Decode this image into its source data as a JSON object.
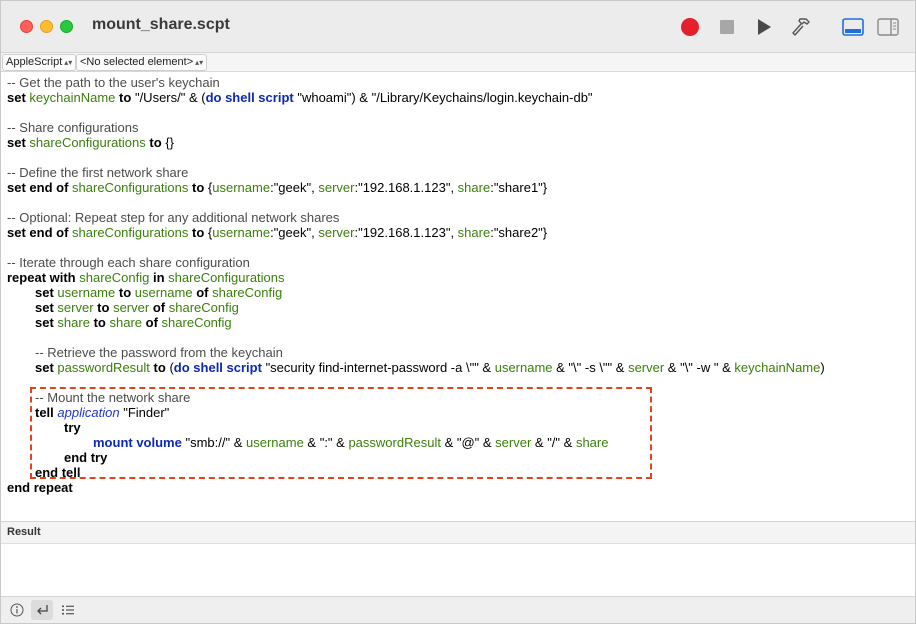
{
  "window": {
    "title": "mount_share.scpt"
  },
  "toolbar": {
    "record": "record-button",
    "stop": "stop-button",
    "run": "run-button",
    "compile": "hammer-icon",
    "show_result_pane": "bottom-panel-icon",
    "show_sidebar": "sidebar-icon"
  },
  "navbar": {
    "language": "AppleScript",
    "element": "<No selected element>"
  },
  "code": {
    "c1": "-- Get the path to the user's keychain",
    "l2": {
      "set": "set",
      "keychainName": "keychainName",
      "to": "to",
      "s1": "\"/Users/\" & (",
      "do": "do shell script",
      "s2": "\"whoami\") & \"/Library/Keychains/login.keychain-db\""
    },
    "c4": "-- Share configurations",
    "l5": {
      "set": "set",
      "shareConfigurations": "shareConfigurations",
      "to": "to",
      "rest": "{}"
    },
    "c7": "-- Define the first network share",
    "l8": {
      "setendof": "set end of",
      "shareConfigurations": "shareConfigurations",
      "to": "to",
      "brace": "{",
      "username": "username",
      "s_user": ":\"geek\", ",
      "server": "server",
      "s_server": ":\"192.168.1.123\", ",
      "share": "share",
      "s_share": ":\"share1\"}"
    },
    "c10": "-- Optional: Repeat step for any additional network shares",
    "l11": {
      "setendof": "set end of",
      "shareConfigurations": "shareConfigurations",
      "to": "to",
      "brace": "{",
      "username": "username",
      "s_user": ":\"geek\", ",
      "server": "server",
      "s_server": ":\"192.168.1.123\", ",
      "share": "share",
      "s_share": ":\"share2\"}"
    },
    "c13": "-- Iterate through each share configuration",
    "l14": {
      "repeatwith": "repeat with",
      "shareConfig": "shareConfig",
      "in": "in",
      "shareConfigurations": "shareConfigurations"
    },
    "l15": {
      "set": "set",
      "v1": "username",
      "to": "to",
      "v2": "username",
      "of": "of",
      "v3": "shareConfig"
    },
    "l16": {
      "set": "set",
      "v1": "server",
      "to": "to",
      "v2": "server",
      "of": "of",
      "v3": "shareConfig"
    },
    "l17": {
      "set": "set",
      "v1": "share",
      "to": "to",
      "v2": "share",
      "of": "of",
      "v3": "shareConfig"
    },
    "c19": "-- Retrieve the password from the keychain",
    "l20": {
      "set": "set",
      "passwordResult": "passwordResult",
      "to": "to",
      "p1": "(",
      "do": "do shell script",
      "s1": "\"security find-internet-password -a \\\"\" & ",
      "username": "username",
      "s2": " & \"\\\" -s \\\"\" & ",
      "server": "server",
      "s3": " & \"\\\" -w \" & ",
      "keychainName": "keychainName",
      "p2": ")"
    },
    "c22": "-- Mount the network share",
    "l23": {
      "tell": "tell",
      "application": "application",
      "s": "\"Finder\""
    },
    "l24": {
      "try": "try"
    },
    "l25": {
      "mount": "mount volume",
      "s1": "\"smb://\" & ",
      "username": "username",
      "s2": " & \":\" & ",
      "passwordResult": "passwordResult",
      "s3": " & \"@\" & ",
      "server": "server",
      "s4": " & \"/\" & ",
      "share": "share"
    },
    "l26": {
      "endtry": "end try"
    },
    "l27": {
      "endtell": "end tell"
    },
    "l28": {
      "endrepeat": "end repeat"
    }
  },
  "result": {
    "title": "Result"
  },
  "bottombar": {
    "info": "info-icon",
    "reply": "reply-icon",
    "log": "list-icon"
  },
  "colors": {
    "comment": "#4c4c4c",
    "variable": "#3a7f0c",
    "command": "#0d29b3",
    "highlight_border": "#e2431c",
    "record_red": "#e5202c"
  }
}
